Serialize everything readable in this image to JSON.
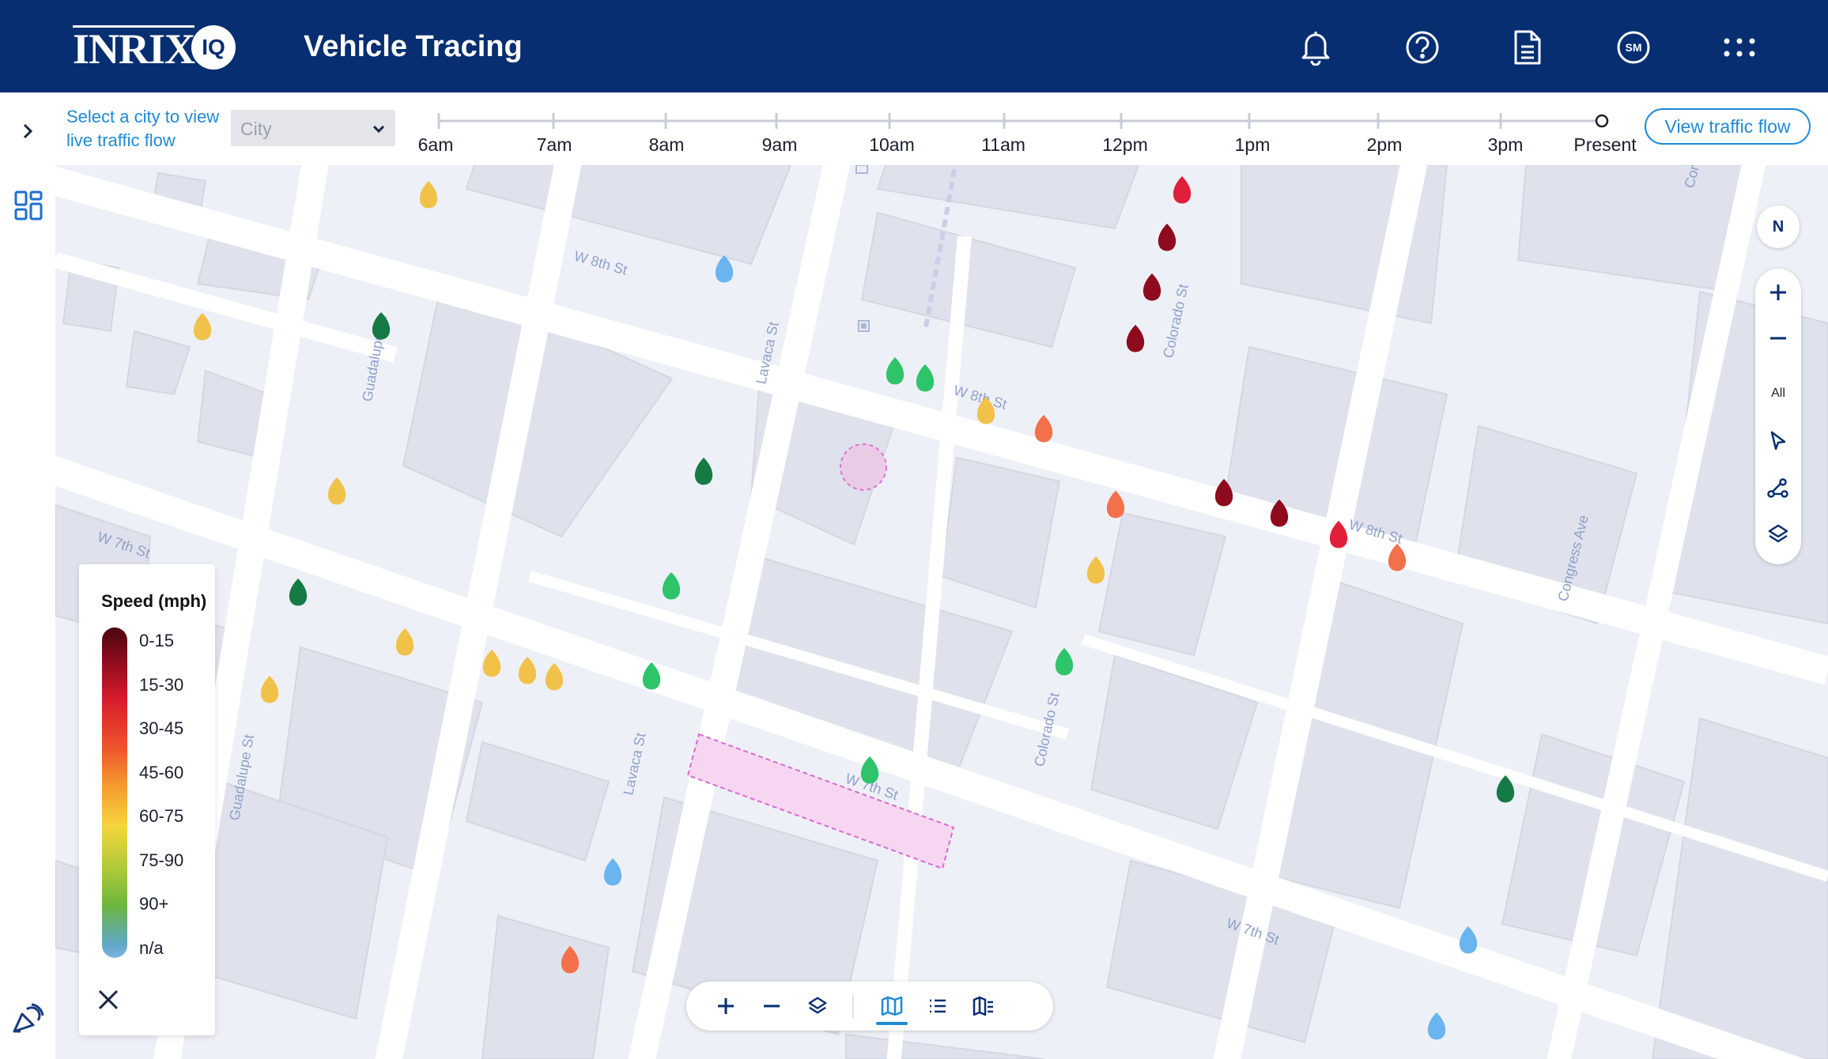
{
  "header": {
    "logo_text": "INRIX",
    "logo_badge": "IQ",
    "app_title": "Vehicle Tracing",
    "icons": [
      "bell-icon",
      "help-icon",
      "document-icon",
      "user-avatar-icon",
      "apps-grid-icon"
    ],
    "avatar_initials": "SM"
  },
  "sidebar": {
    "icons": [
      "chevron-right-icon",
      "dashboard-icon",
      "broadcast-icon"
    ]
  },
  "toolbar": {
    "select_hint": "Select a city to view live traffic flow",
    "city_placeholder": "City",
    "timeline_labels": [
      "6am",
      "7am",
      "8am",
      "9am",
      "10am",
      "11am",
      "12pm",
      "1pm",
      "2pm",
      "3pm",
      "Present"
    ],
    "view_traffic_flow_label": "View traffic flow"
  },
  "map": {
    "street_labels": [
      "W 8th St",
      "W 8th St",
      "W 8th St",
      "W 7th St",
      "W 7th St",
      "W 7th St",
      "Guadalupe St",
      "Guadalupe St",
      "Lavaca St",
      "Lavaca St",
      "Colorado St",
      "Colorado St",
      "Congress Ave",
      "Cor"
    ],
    "legend": {
      "title": "Speed (mph)",
      "items": [
        "0-15",
        "15-30",
        "30-45",
        "45-60",
        "60-75",
        "75-90",
        "90+",
        "n/a"
      ],
      "colors": {
        "dark_red": "#8e0b1e",
        "red": "#e0203a",
        "orange": "#f2714a",
        "yellow": "#f0c24a",
        "green": "#2ec46a",
        "dark_green": "#167a45",
        "blue": "#6ab5f0"
      }
    },
    "controls": {
      "north_label": "N",
      "all_label": "All"
    }
  }
}
